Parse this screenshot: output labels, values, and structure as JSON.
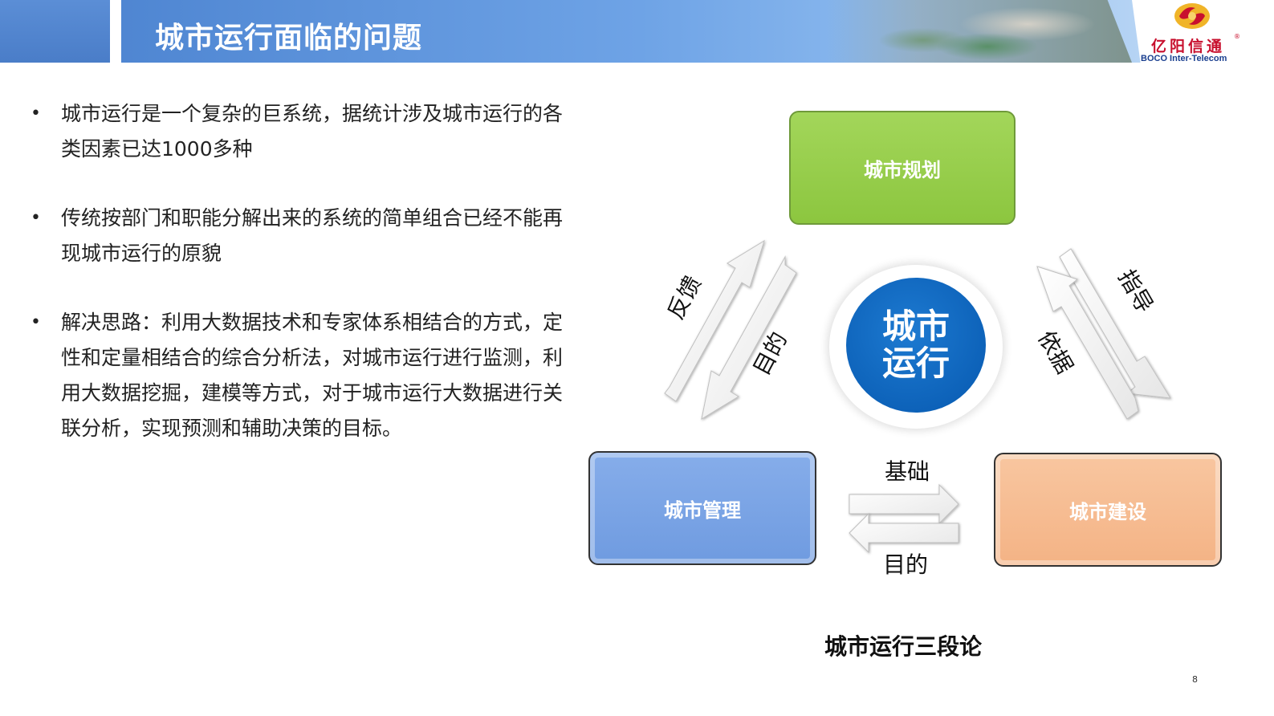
{
  "header": {
    "title": "城市运行面临的问题"
  },
  "logo": {
    "cn": "亿阳信通",
    "reg": "®",
    "en": "BOCO Inter-Telecom"
  },
  "bullets": [
    {
      "text": "城市运行是一个复杂的巨系统，据统计涉及城市运行的各类因素已达1000多种"
    },
    {
      "text": "传统按部门和职能分解出来的系统的简单组合已经不能再现城市运行的原貌"
    },
    {
      "text": "解决思路：利用大数据技术和专家体系相结合的方式，定性和定量相结合的综合分析法，对城市运行进行监测，利用大数据挖掘，建模等方式，对于城市运行大数据进行关联分析，实现预测和辅助决策的目标。"
    }
  ],
  "diagram": {
    "box_plan": "城市规划",
    "box_manage": "城市管理",
    "box_build": "城市建设",
    "center": "城市运行",
    "label_feedback": "反馈",
    "label_purpose_left": "目的",
    "label_guide": "指导",
    "label_basis": "依据",
    "label_foundation": "基础",
    "label_purpose_bottom": "目的",
    "title": "城市运行三段论"
  },
  "page_number": "8",
  "colors": {
    "header_blue": "#4f86d2",
    "plan_green": "#8cc63f",
    "manage_blue": "#6f9be0",
    "build_orange": "#f4b385",
    "center_blue": "#0b5fb6",
    "logo_red": "#c8102e"
  }
}
